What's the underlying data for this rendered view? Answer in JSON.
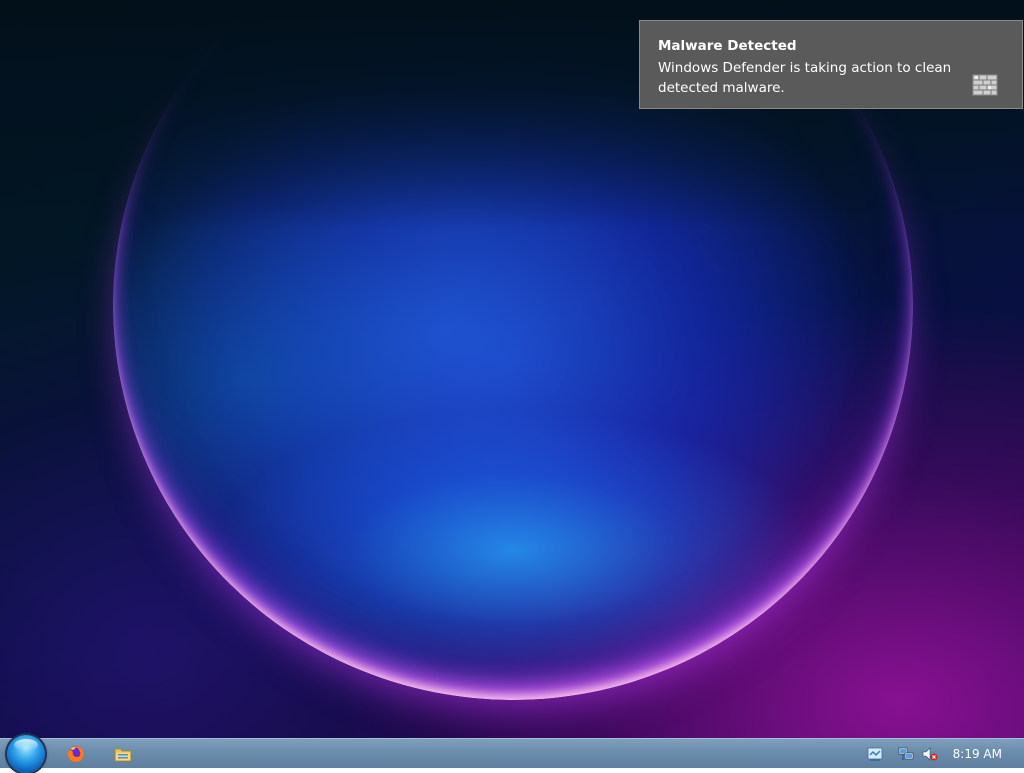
{
  "notification": {
    "title": "Malware Detected",
    "body": "Windows Defender is taking action to clean detected malware.",
    "icon": "defender-wall-icon"
  },
  "taskbar": {
    "start_button_icon": "windows-orb-icon",
    "pinned": [
      {
        "name": "firefox",
        "icon": "firefox-icon"
      },
      {
        "name": "file-explorer",
        "icon": "folder-icon"
      }
    ],
    "tray": [
      {
        "name": "action-center",
        "icon": "action-center-flag-icon"
      },
      {
        "name": "network",
        "icon": "network-icon"
      },
      {
        "name": "volume",
        "icon": "volume-muted-icon"
      }
    ],
    "clock": "8:19 AM"
  },
  "colors": {
    "toast_bg": "#5a5a5a",
    "taskbar": "#6b8cab"
  }
}
